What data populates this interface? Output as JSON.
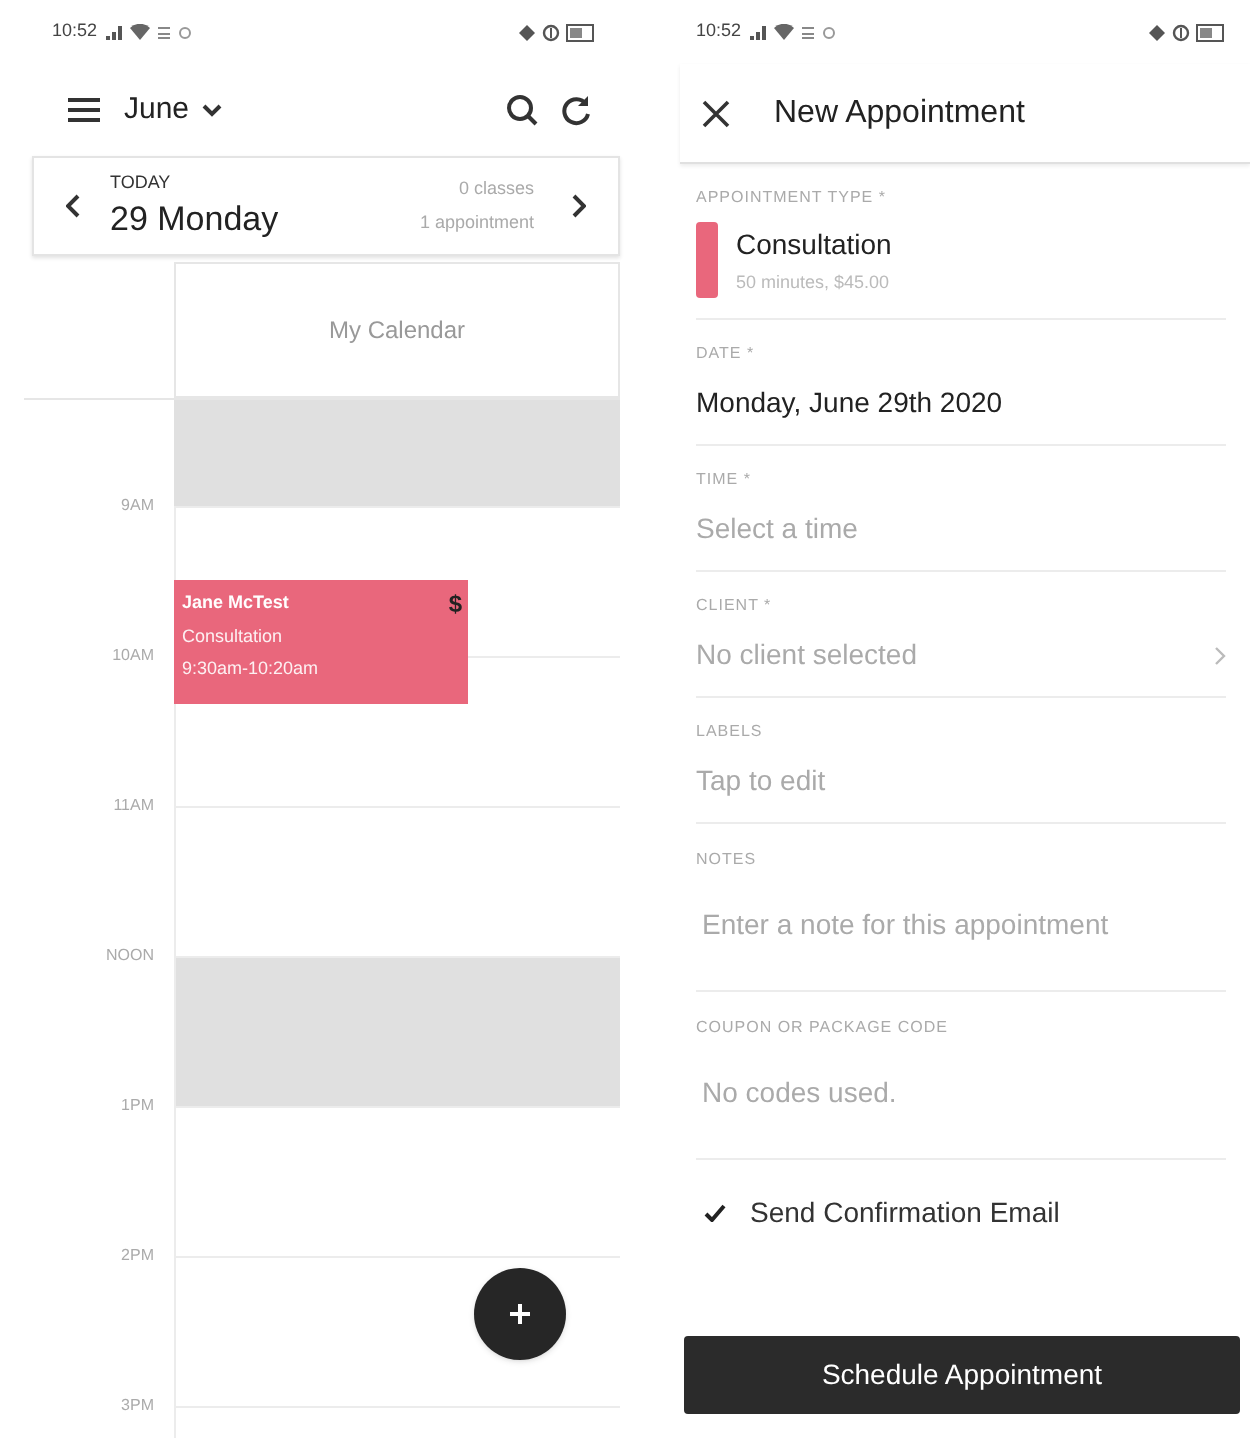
{
  "calendar_screen": {
    "status_bar": {
      "time": "10:52"
    },
    "header": {
      "month": "June"
    },
    "day_bar": {
      "caption": "TODAY",
      "date": "29 Monday",
      "classes": "0 classes",
      "appointments": "1 appointment"
    },
    "column_header": "My Calendar",
    "leading_block_shaded": true,
    "hours": [
      {
        "label": "9AM",
        "shaded": false
      },
      {
        "label": "10AM",
        "shaded": false
      },
      {
        "label": "11AM",
        "shaded": false
      },
      {
        "label": "NOON",
        "shaded": true
      },
      {
        "label": "1PM",
        "shaded": false
      },
      {
        "label": "2PM",
        "shaded": false
      },
      {
        "label": "3PM",
        "shaded": false
      }
    ],
    "events": [
      {
        "client": "Jane McTest",
        "type": "Consultation",
        "time": "9:30am-10:20am",
        "marker": "$",
        "color": "#e9677c"
      }
    ]
  },
  "appointment_screen": {
    "status_bar": {
      "time": "10:52"
    },
    "title": "New Appointment",
    "fields": [
      {
        "kind": "appointment_type",
        "label": "APPOINTMENT TYPE *",
        "name": "Consultation",
        "detail": "50 minutes, $45.00",
        "color": "#e9677c"
      },
      {
        "kind": "text",
        "label": "DATE *",
        "value": "Monday, June 29th 2020"
      },
      {
        "kind": "picker",
        "label": "TIME *",
        "placeholder": "Select a time"
      },
      {
        "kind": "chevron_picker",
        "label": "CLIENT *",
        "placeholder": "No client selected"
      },
      {
        "kind": "picker",
        "label": "LABELS",
        "placeholder": "Tap to edit"
      },
      {
        "kind": "textarea",
        "label": "NOTES",
        "placeholder": "Enter a note for this appointment"
      },
      {
        "kind": "textarea",
        "label": "COUPON OR PACKAGE CODE",
        "placeholder": "No codes used."
      }
    ],
    "confirmation": {
      "label": "Send Confirmation Email",
      "checked": true
    },
    "submit": "Schedule Appointment"
  }
}
